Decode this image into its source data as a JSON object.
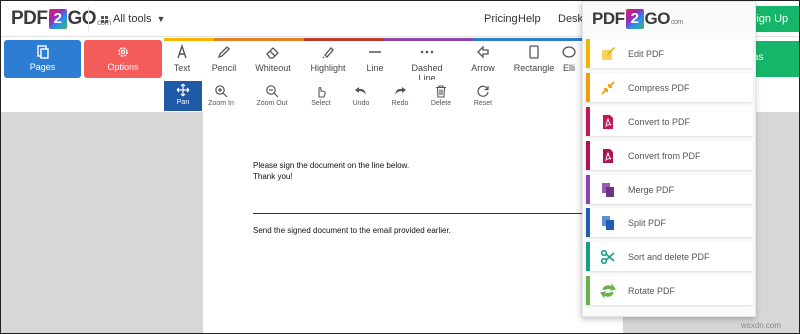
{
  "header": {
    "logo": {
      "left": "PDF",
      "mid": "2",
      "right": "GO",
      "suffix": "com"
    },
    "all_tools": "All tools",
    "nav": [
      "Pricing",
      "Help",
      "Deskto"
    ],
    "signup": "Sign Up"
  },
  "toolbar": {
    "pages": "Pages",
    "options": "Options",
    "tools": [
      "Text",
      "Pencil",
      "Whiteout",
      "Highlight",
      "Line",
      "Dashed Line",
      "Arrow",
      "Rectangle",
      "Elli"
    ],
    "right_button": "as",
    "row2": [
      "Pan",
      "Zoom In",
      "Zoom Out",
      "Select",
      "Undo",
      "Redo",
      "Delete",
      "Reset"
    ]
  },
  "document": {
    "line1": "Please sign the document on the line below.",
    "line2": "Thank you!",
    "line3": "Send the signed document to the email provided earlier."
  },
  "dropdown": {
    "items": [
      {
        "label": "Edit PDF",
        "color": "#f5b400",
        "icon": "edit-icon"
      },
      {
        "label": "Compress PDF",
        "color": "#f39c12",
        "icon": "compress-icon"
      },
      {
        "label": "Convert to PDF",
        "color": "#c2185b",
        "icon": "pdf-icon"
      },
      {
        "label": "Convert from PDF",
        "color": "#ad1457",
        "icon": "pdf-icon"
      },
      {
        "label": "Merge PDF",
        "color": "#8e44ad",
        "icon": "merge-icon"
      },
      {
        "label": "Split PDF",
        "color": "#1e5fb3",
        "icon": "split-icon"
      },
      {
        "label": "Sort and delete PDF",
        "color": "#16a085",
        "icon": "scissors-icon"
      },
      {
        "label": "Rotate PDF",
        "color": "#6ab04c",
        "icon": "rotate-icon"
      }
    ]
  },
  "watermark": "wsxdn.com",
  "colors": {
    "pages": "#2d7dd2",
    "options": "#f45b5b",
    "active": "#1f5aa6",
    "green": "#16b66a"
  }
}
